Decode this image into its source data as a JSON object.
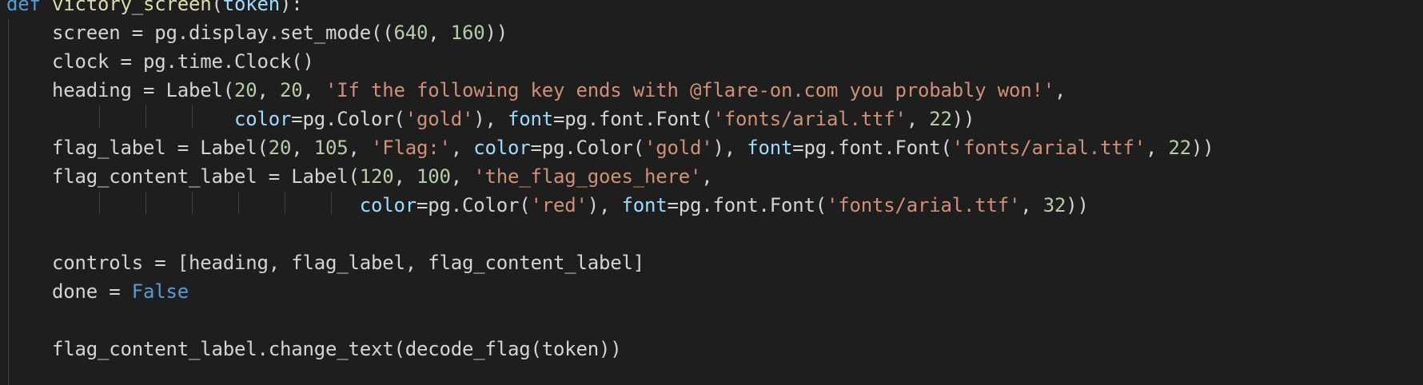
{
  "editor": {
    "theme_colors": {
      "background": "#1e1e1e",
      "keyword": "#569cd6",
      "function": "#dcdcaa",
      "parameter": "#9cdcfe",
      "number": "#b5cea8",
      "string": "#ce9178",
      "text": "#d4d4d4"
    },
    "lines": [
      [
        {
          "t": "def",
          "k": "kw"
        },
        {
          "t": " ",
          "k": "plain"
        },
        {
          "t": "victory_screen",
          "k": "fn"
        },
        {
          "t": "(",
          "k": "plain"
        },
        {
          "t": "token",
          "k": "param"
        },
        {
          "t": "):",
          "k": "plain"
        }
      ],
      [
        {
          "t": "    screen = pg.display.set_mode((",
          "k": "plain"
        },
        {
          "t": "640",
          "k": "num"
        },
        {
          "t": ", ",
          "k": "plain"
        },
        {
          "t": "160",
          "k": "num"
        },
        {
          "t": "))",
          "k": "plain"
        }
      ],
      [
        {
          "t": "    clock = pg.time.Clock()",
          "k": "plain"
        }
      ],
      [
        {
          "t": "    heading = Label(",
          "k": "plain"
        },
        {
          "t": "20",
          "k": "num"
        },
        {
          "t": ", ",
          "k": "plain"
        },
        {
          "t": "20",
          "k": "num"
        },
        {
          "t": ", ",
          "k": "plain"
        },
        {
          "t": "'If the following key ends with @flare-on.com you probably won!'",
          "k": "str"
        },
        {
          "t": ",",
          "k": "plain"
        }
      ],
      [
        {
          "t": "                    ",
          "k": "plain"
        },
        {
          "t": "color",
          "k": "param"
        },
        {
          "t": "=pg.Color(",
          "k": "plain"
        },
        {
          "t": "'gold'",
          "k": "str"
        },
        {
          "t": "), ",
          "k": "plain"
        },
        {
          "t": "font",
          "k": "param"
        },
        {
          "t": "=pg.font.Font(",
          "k": "plain"
        },
        {
          "t": "'fonts/arial.ttf'",
          "k": "str"
        },
        {
          "t": ", ",
          "k": "plain"
        },
        {
          "t": "22",
          "k": "num"
        },
        {
          "t": "))",
          "k": "plain"
        }
      ],
      [
        {
          "t": "    flag_label = Label(",
          "k": "plain"
        },
        {
          "t": "20",
          "k": "num"
        },
        {
          "t": ", ",
          "k": "plain"
        },
        {
          "t": "105",
          "k": "num"
        },
        {
          "t": ", ",
          "k": "plain"
        },
        {
          "t": "'Flag:'",
          "k": "str"
        },
        {
          "t": ", ",
          "k": "plain"
        },
        {
          "t": "color",
          "k": "param"
        },
        {
          "t": "=pg.Color(",
          "k": "plain"
        },
        {
          "t": "'gold'",
          "k": "str"
        },
        {
          "t": "), ",
          "k": "plain"
        },
        {
          "t": "font",
          "k": "param"
        },
        {
          "t": "=pg.font.Font(",
          "k": "plain"
        },
        {
          "t": "'fonts/arial.ttf'",
          "k": "str"
        },
        {
          "t": ", ",
          "k": "plain"
        },
        {
          "t": "22",
          "k": "num"
        },
        {
          "t": "))",
          "k": "plain"
        }
      ],
      [
        {
          "t": "    flag_content_label = Label(",
          "k": "plain"
        },
        {
          "t": "120",
          "k": "num"
        },
        {
          "t": ", ",
          "k": "plain"
        },
        {
          "t": "100",
          "k": "num"
        },
        {
          "t": ", ",
          "k": "plain"
        },
        {
          "t": "'the_flag_goes_here'",
          "k": "str"
        },
        {
          "t": ",",
          "k": "plain"
        }
      ],
      [
        {
          "t": "                               ",
          "k": "plain"
        },
        {
          "t": "color",
          "k": "param"
        },
        {
          "t": "=pg.Color(",
          "k": "plain"
        },
        {
          "t": "'red'",
          "k": "str"
        },
        {
          "t": "), ",
          "k": "plain"
        },
        {
          "t": "font",
          "k": "param"
        },
        {
          "t": "=pg.font.Font(",
          "k": "plain"
        },
        {
          "t": "'fonts/arial.ttf'",
          "k": "str"
        },
        {
          "t": ", ",
          "k": "plain"
        },
        {
          "t": "32",
          "k": "num"
        },
        {
          "t": "))",
          "k": "plain"
        }
      ],
      [],
      [
        {
          "t": "    controls = [heading, flag_label, flag_content_label]",
          "k": "plain"
        }
      ],
      [
        {
          "t": "    done = ",
          "k": "plain"
        },
        {
          "t": "False",
          "k": "bool"
        }
      ],
      [],
      [
        {
          "t": "    flag_content_label.change_text(decode_flag(token))",
          "k": "plain"
        }
      ]
    ]
  }
}
